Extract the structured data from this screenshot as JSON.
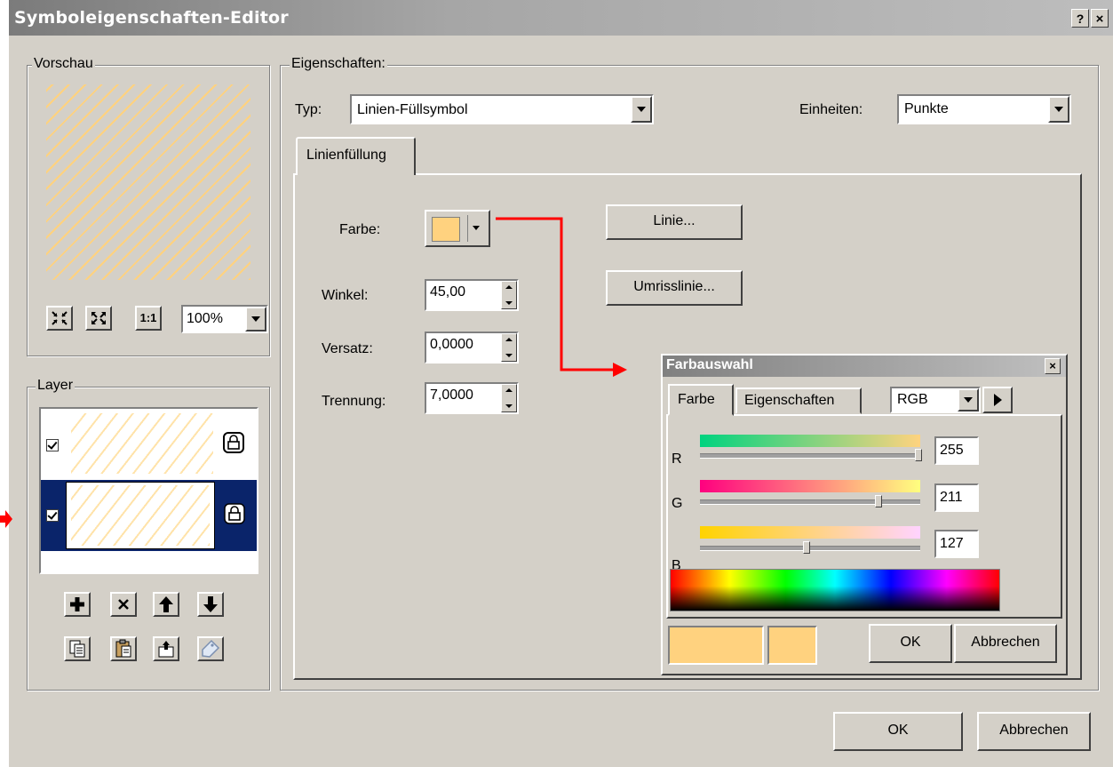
{
  "window": {
    "title": "Symboleigenschaften-Editor",
    "help_label": "?",
    "close_label": "×"
  },
  "preview": {
    "group_label": "Vorschau",
    "zoom_value": "100%",
    "actual_size_label": "1:1"
  },
  "layer": {
    "group_label": "Layer"
  },
  "properties": {
    "group_label": "Eigenschaften:",
    "type_label": "Typ:",
    "type_value": "Linien-Füllsymbol",
    "units_label": "Einheiten:",
    "units_value": "Punkte",
    "tab_label": "Linienfüllung",
    "color_label": "Farbe:",
    "line_button": "Linie...",
    "outline_button": "Umrisslinie...",
    "angle_label": "Winkel:",
    "angle_value": "45,00",
    "offset_label": "Versatz:",
    "offset_value": "0,0000",
    "separation_label": "Trennung:",
    "separation_value": "7,0000"
  },
  "color_picker": {
    "title": "Farbauswahl",
    "close_label": "×",
    "tab_color": "Farbe",
    "tab_properties": "Eigenschaften",
    "model_value": "RGB",
    "r_label": "R",
    "r_value": "255",
    "g_label": "G",
    "g_value": "211",
    "b_label": "B",
    "b_value": "127",
    "ok_button": "OK",
    "cancel_button": "Abbrechen"
  },
  "footer": {
    "ok_button": "OK",
    "cancel_button": "Abbrechen"
  },
  "colors": {
    "fill_color": "#ffd27f",
    "annotation_arrow": "#ff0000",
    "selection": "#0a246a"
  }
}
